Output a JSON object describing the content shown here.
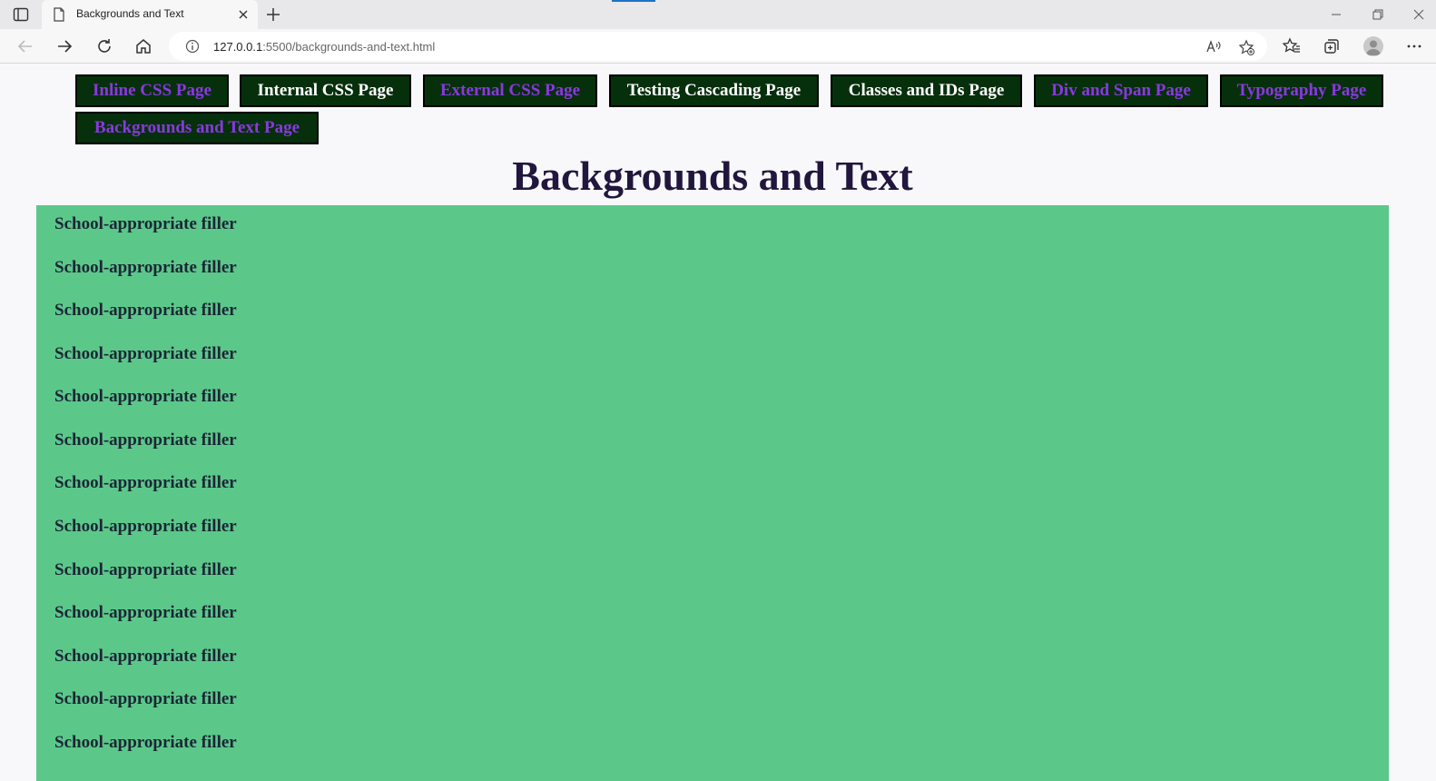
{
  "browser": {
    "tab_title": "Backgrounds and Text",
    "url_host": "127.0.0.1",
    "url_rest": ":5500/backgrounds-and-text.html",
    "icons": {
      "tab_actions": "tab-actions-icon",
      "page": "page-icon",
      "tab_close": "close-icon",
      "new_tab": "plus-icon",
      "back": "arrow-left-icon",
      "forward": "arrow-right-icon",
      "refresh": "refresh-icon",
      "home": "home-icon",
      "site_info": "info-icon",
      "read_aloud": "read-aloud-icon",
      "add_favorite": "star-plus-icon",
      "favorites": "favorites-icon",
      "collections": "collections-icon",
      "profile": "profile-avatar",
      "more": "ellipsis-icon"
    }
  },
  "nav": {
    "links": [
      {
        "label": "Inline CSS Page",
        "state": "visited"
      },
      {
        "label": "Internal CSS Page",
        "state": "unvisited"
      },
      {
        "label": "External CSS Page",
        "state": "visited"
      },
      {
        "label": "Testing Cascading Page",
        "state": "unvisited"
      },
      {
        "label": "Classes and IDs Page",
        "state": "unvisited"
      },
      {
        "label": "Div and Span Page",
        "state": "visited"
      },
      {
        "label": "Typography Page",
        "state": "visited"
      },
      {
        "label": "Backgrounds and Text Page",
        "state": "visited"
      }
    ]
  },
  "page": {
    "heading": "Backgrounds and Text",
    "fillers": [
      "School-appropriate filler",
      "School-appropriate filler",
      "School-appropriate filler",
      "School-appropriate filler",
      "School-appropriate filler",
      "School-appropriate filler",
      "School-appropriate filler",
      "School-appropriate filler",
      "School-appropriate filler",
      "School-appropriate filler",
      "School-appropriate filler",
      "School-appropriate filler",
      "School-appropriate filler"
    ]
  },
  "colors": {
    "nav_background": "#06300c",
    "visited_link": "#8a38e0",
    "unvisited_link": "#ffffff",
    "heading": "#21163d",
    "content_background": "#5bc88a",
    "page_background": "#f8f8fb"
  }
}
